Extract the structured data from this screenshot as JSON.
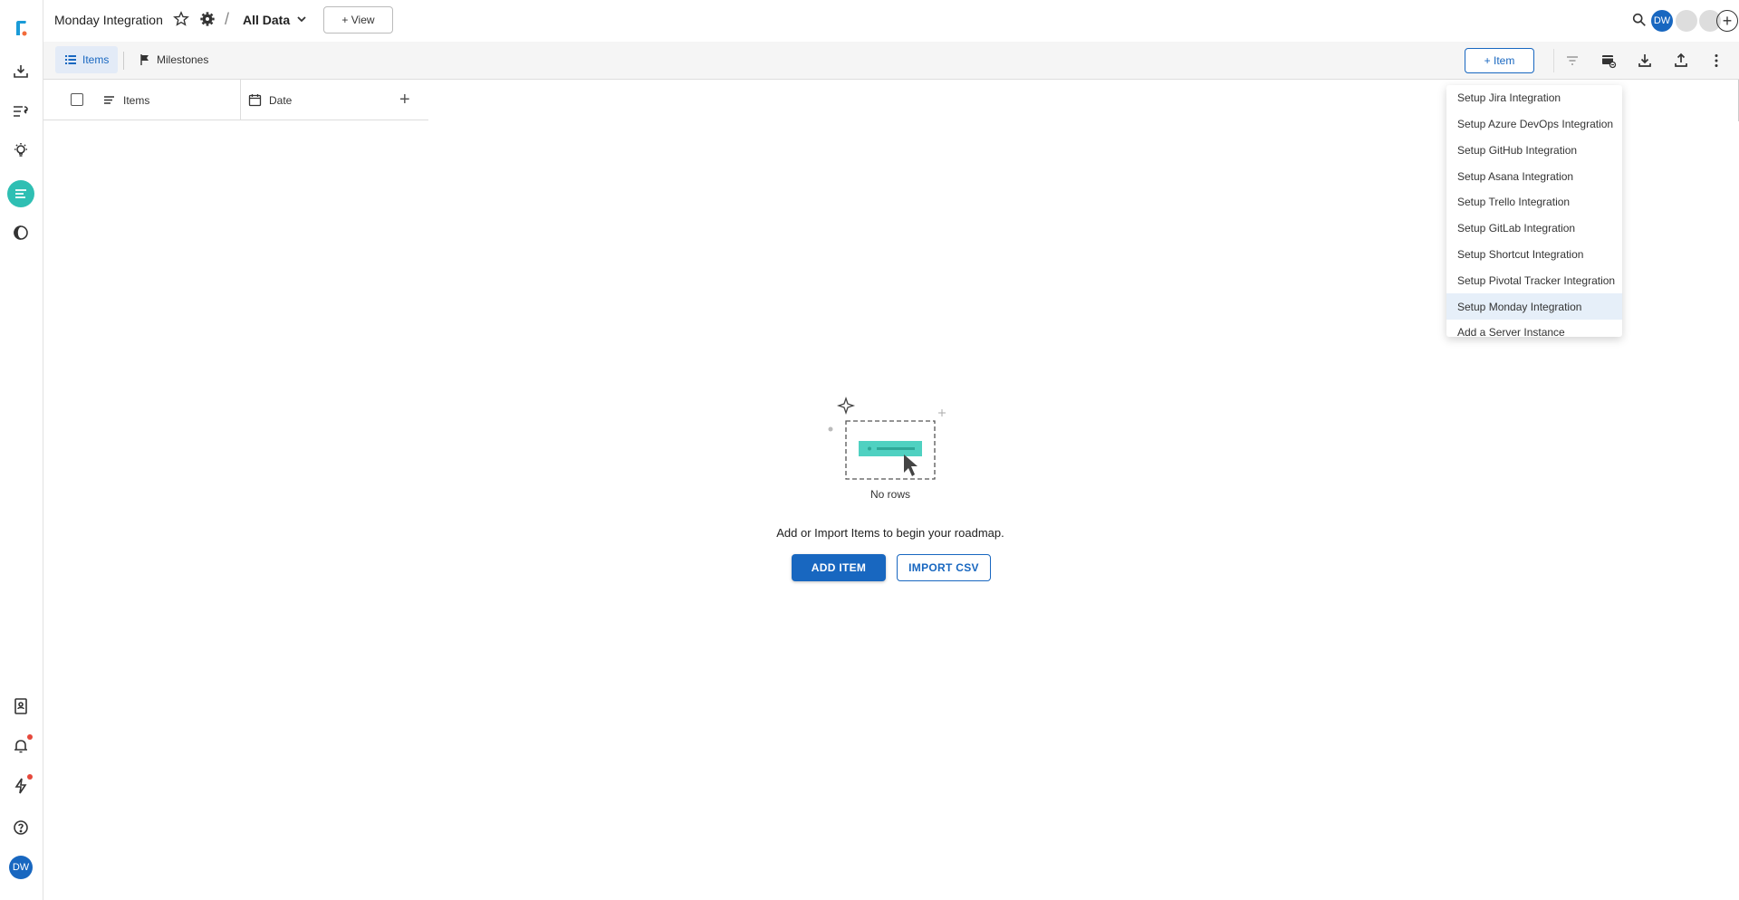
{
  "header": {
    "project_title": "Monday Integration",
    "separator": "/",
    "view_name": "All Data",
    "add_view_label": "+ View",
    "user_initials": "DW",
    "add_label": "+"
  },
  "toolbar": {
    "tabs": [
      {
        "label": "Items",
        "icon": "list-icon",
        "active": true
      },
      {
        "label": "Milestones",
        "icon": "flag-icon",
        "active": false
      }
    ],
    "add_item_label": "+ Item",
    "icons": [
      "filter-icon",
      "integration-icon",
      "download-icon",
      "upload-icon",
      "more-vert-icon"
    ]
  },
  "grid": {
    "columns": [
      {
        "label": "Items",
        "icon": "lines-icon"
      },
      {
        "label": "Date",
        "icon": "calendar-icon"
      }
    ],
    "add_column_label": "+"
  },
  "empty_state": {
    "no_rows": "No rows",
    "message": "Add or Import Items to begin your roadmap.",
    "add_item_button": "ADD ITEM",
    "import_csv_button": "IMPORT CSV"
  },
  "integration_menu": {
    "items": [
      "Setup Jira Integration",
      "Setup Azure DevOps Integration",
      "Setup GitHub Integration",
      "Setup Asana Integration",
      "Setup Trello Integration",
      "Setup GitLab Integration",
      "Setup Shortcut Integration",
      "Setup Pivotal Tracker Integration",
      "Setup Monday Integration",
      "Add a Server Instance"
    ],
    "selected": "Setup Monday Integration"
  },
  "sidebar": {
    "user_initials": "DW"
  },
  "colors": {
    "accent": "#1867c0",
    "teal": "#2fbfb3",
    "notification_dot": "#e5483b"
  }
}
